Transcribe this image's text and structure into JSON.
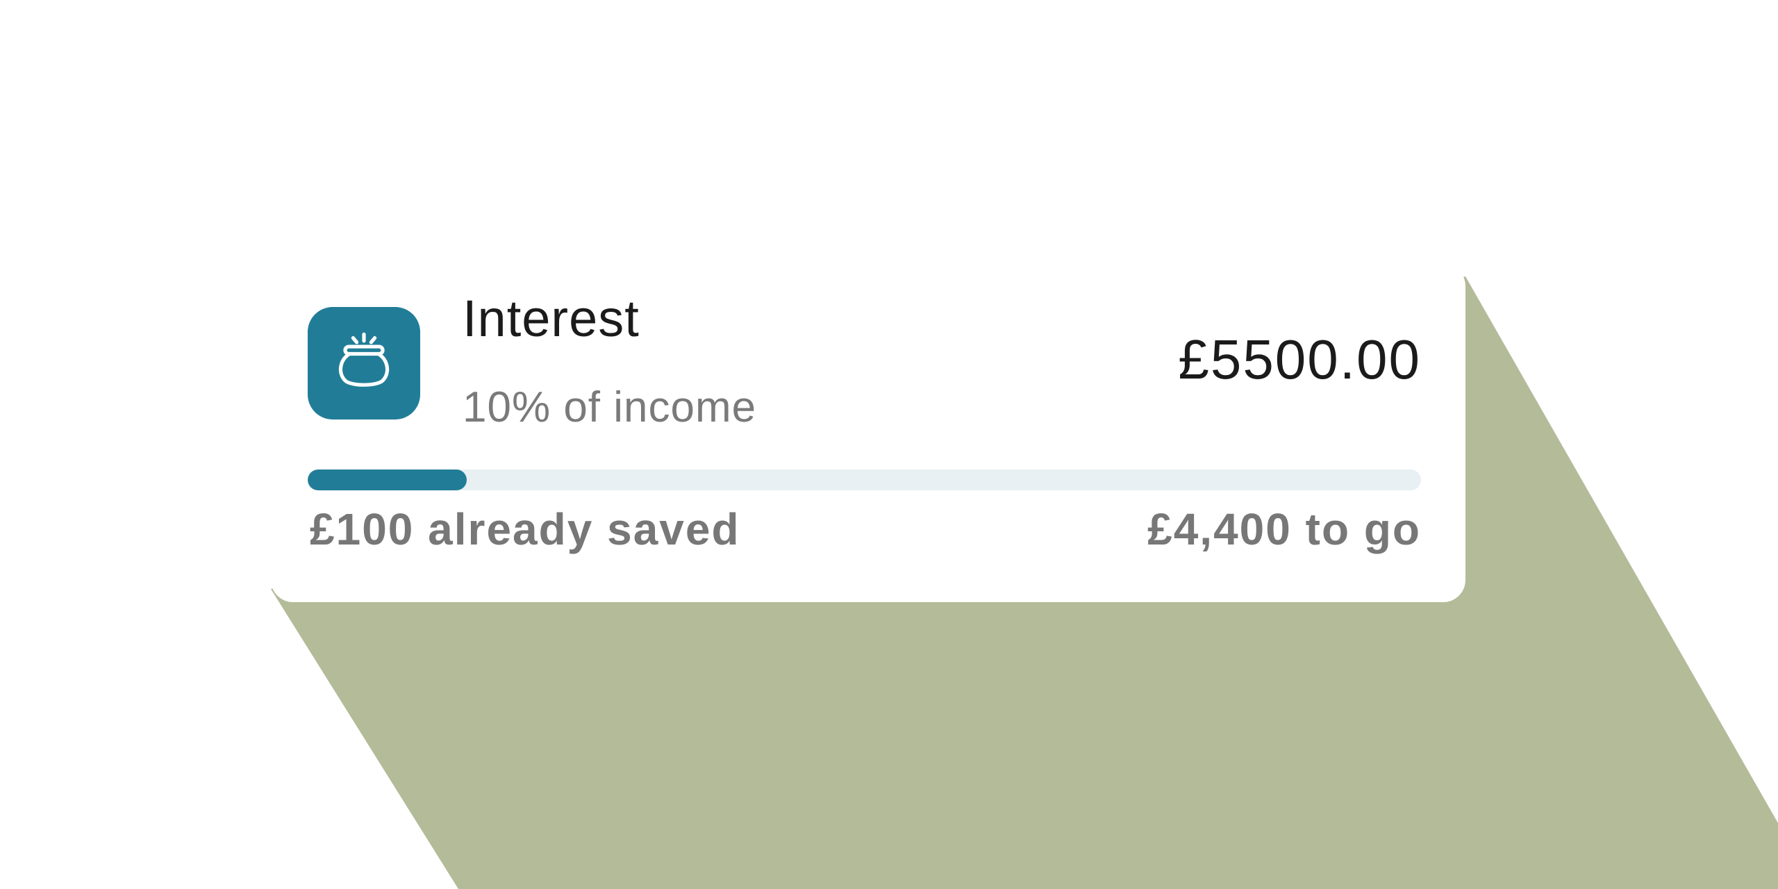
{
  "colors": {
    "accent": "#217d97",
    "track": "#e8f0f3",
    "backdrop": "#b3bb98",
    "background": "#ffffff"
  },
  "savings_pot": {
    "icon": "pot-icon",
    "title": "Interest",
    "subtitle": "10% of income",
    "amount": "£5500.00",
    "progress_fraction": 0.143,
    "saved_label": "£100 already saved",
    "remaining_label": "£4,400 to go"
  }
}
